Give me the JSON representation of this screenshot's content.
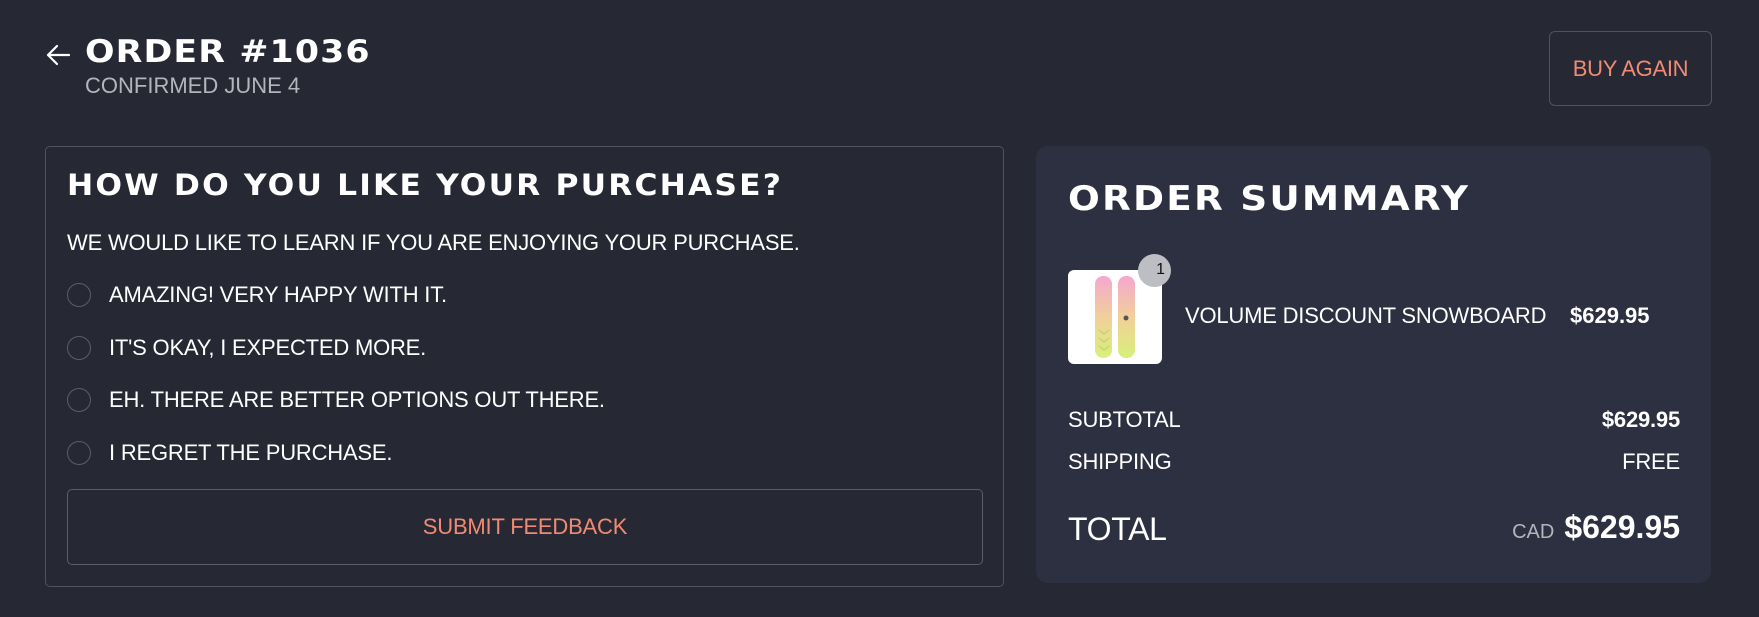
{
  "header": {
    "title": "ORDER #1036",
    "subtitle": "CONFIRMED JUNE 4",
    "buy_again_label": "BUY AGAIN"
  },
  "feedback": {
    "heading": "HOW DO YOU LIKE YOUR PURCHASE?",
    "description": "WE WOULD LIKE TO LEARN IF YOU ARE ENJOYING YOUR PURCHASE.",
    "options": [
      {
        "label": "AMAZING! VERY HAPPY WITH IT.",
        "selected": false
      },
      {
        "label": "IT'S OKAY, I EXPECTED MORE.",
        "selected": false
      },
      {
        "label": "EH. THERE ARE BETTER OPTIONS OUT THERE.",
        "selected": false
      },
      {
        "label": "I REGRET THE PURCHASE.",
        "selected": false
      }
    ],
    "submit_label": "SUBMIT FEEDBACK"
  },
  "summary": {
    "heading": "ORDER SUMMARY",
    "item": {
      "name": "VOLUME DISCOUNT SNOWBOARD",
      "price": "$629.95",
      "quantity": "1",
      "image_icon": "snowboard-image"
    },
    "subtotal_label": "SUBTOTAL",
    "subtotal_value": "$629.95",
    "shipping_label": "SHIPPING",
    "shipping_value": "FREE",
    "total_label": "TOTAL",
    "currency": "CAD",
    "total_value": "$629.95"
  },
  "colors": {
    "background": "#262934",
    "accent": "#f08a72",
    "summary_card": "#2d3040",
    "border": "#4f5360"
  }
}
